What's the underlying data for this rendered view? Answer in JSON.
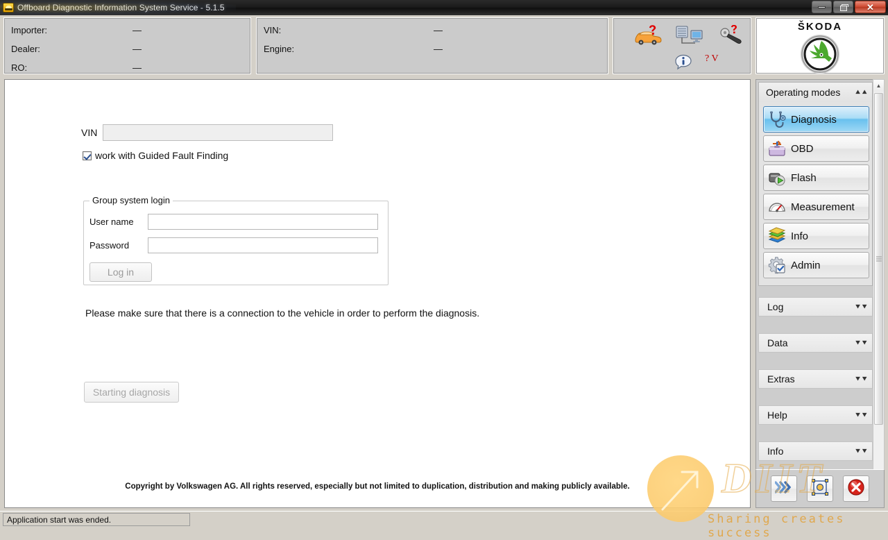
{
  "window": {
    "title": "Offboard Diagnostic Information System Service - 5.1.5",
    "app_icon": "car-app-icon",
    "minimize_label": "Minimize",
    "maximize_label": "Restore",
    "close_label": "Close"
  },
  "header": {
    "left_panel": {
      "rows": [
        {
          "label": "Importer:",
          "value": "—"
        },
        {
          "label": "Dealer:",
          "value": "—"
        },
        {
          "label": "RO:",
          "value": "—"
        }
      ]
    },
    "middle_panel": {
      "rows": [
        {
          "label": "VIN:",
          "value": "—"
        },
        {
          "label": "Engine:",
          "value": "—"
        }
      ]
    },
    "icons": [
      {
        "name": "vehicle-help-icon",
        "alt": "Vehicle help"
      },
      {
        "name": "network-connection-icon",
        "alt": "Connection / server"
      },
      {
        "name": "key-help-icon",
        "alt": "Login help"
      },
      {
        "name": "info-icon",
        "alt": "Information"
      },
      {
        "name": "question-version-icon",
        "alt": "? V"
      }
    ],
    "version_marker": "? V",
    "brand": {
      "wordmark": "ŠKODA",
      "logo_name": "skoda-winged-arrow-logo",
      "green": "#4ba82e"
    }
  },
  "main": {
    "vin": {
      "label": "VIN",
      "value": "",
      "placeholder": "",
      "disabled": true
    },
    "guided_fault_finding": {
      "label": "work with Guided Fault Finding",
      "checked": true
    },
    "group_login": {
      "legend": "Group system login",
      "username": {
        "label": "User name",
        "value": "",
        "placeholder": ""
      },
      "password": {
        "label": "Password",
        "value": "",
        "placeholder": ""
      },
      "login_button": {
        "label": "Log in",
        "disabled": true
      }
    },
    "hint": "Please make sure that there is a connection to the vehicle in order to perform the diagnosis.",
    "start_button": {
      "label": "Starting diagnosis",
      "disabled": true
    },
    "copyright": "Copyright by Volkswagen AG. All rights reserved, especially but not limited to duplication, distribution and making publicly available."
  },
  "sidebar": {
    "operating_modes": {
      "title": "Operating modes",
      "collapse_icon": "chevron-up-double-icon",
      "items": [
        {
          "label": "Diagnosis",
          "icon": "stethoscope-icon",
          "active": true
        },
        {
          "label": "OBD",
          "icon": "toolbox-icon",
          "active": false
        },
        {
          "label": "Flash",
          "icon": "flash-module-icon",
          "active": false
        },
        {
          "label": "Measurement",
          "icon": "gauge-icon",
          "active": false
        },
        {
          "label": "Info",
          "icon": "books-icon",
          "active": false
        },
        {
          "label": "Admin",
          "icon": "gear-check-icon",
          "active": false
        }
      ],
      "active_color": "#69c0ee"
    },
    "sections": [
      {
        "label": "Log",
        "expand_icon": "chevron-down-double-icon"
      },
      {
        "label": "Data",
        "expand_icon": "chevron-down-double-icon"
      },
      {
        "label": "Extras",
        "expand_icon": "chevron-down-double-icon"
      },
      {
        "label": "Help",
        "expand_icon": "chevron-down-double-icon"
      },
      {
        "label": "Info",
        "expand_icon": "chevron-down-double-icon"
      }
    ],
    "scrollbar": {
      "up_arrow": "▲",
      "down_arrow": "▼"
    }
  },
  "bottom_bar": {
    "buttons": [
      {
        "name": "next-button",
        "icon": "double-chevron-right-icon",
        "label": "Next"
      },
      {
        "name": "select-button",
        "icon": "selection-frame-icon",
        "label": "Select"
      },
      {
        "name": "cancel-button",
        "icon": "red-x-circle-icon",
        "label": "Cancel"
      }
    ]
  },
  "status_bar": {
    "message": "Application start was ended."
  },
  "watermark": {
    "logo_text": "DIIT",
    "tagline": "Sharing creates success",
    "accent": "#e0a84e"
  }
}
